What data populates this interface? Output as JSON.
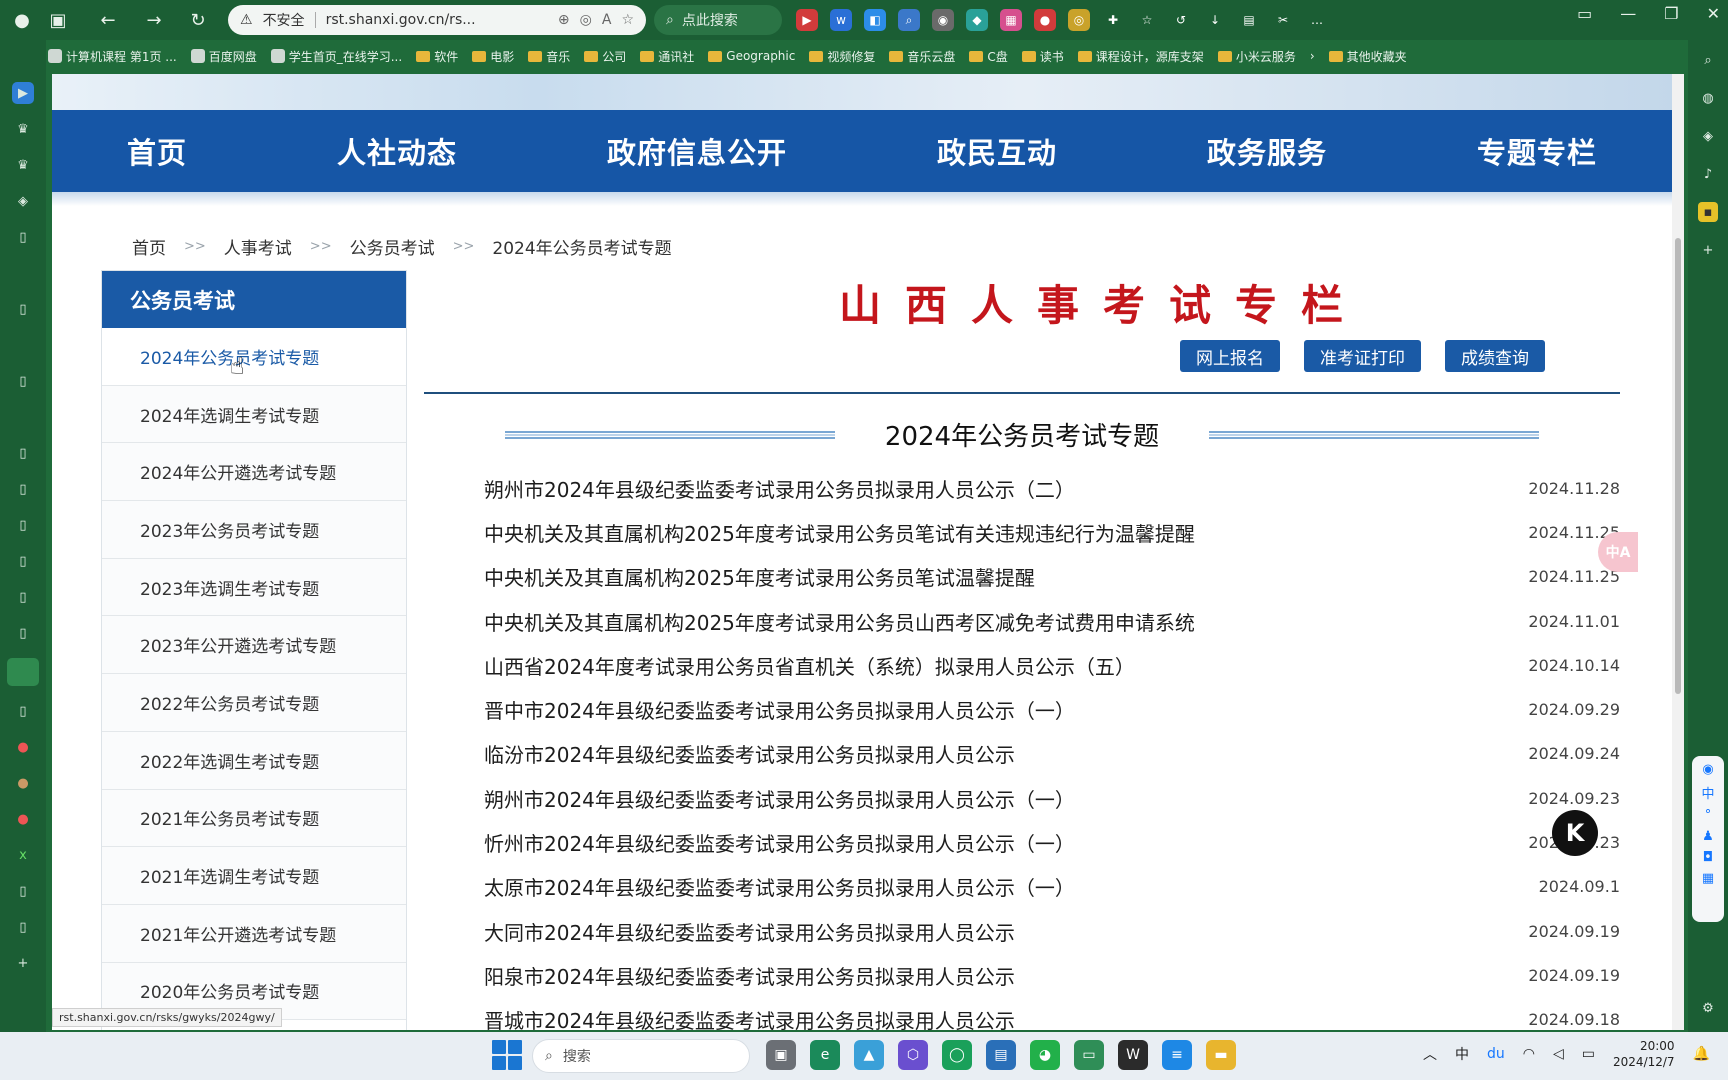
{
  "browser": {
    "security_label": "不安全",
    "url": "rst.shanxi.gov.cn/rs...",
    "search_placeholder": "点此搜索",
    "bookmarks": [
      {
        "label": "计算机课程 第1页 ..."
      },
      {
        "label": "百度网盘"
      },
      {
        "label": "学生首页_在线学习..."
      },
      {
        "label": "软件"
      },
      {
        "label": "电影"
      },
      {
        "label": "音乐"
      },
      {
        "label": "公司"
      },
      {
        "label": "通讯社"
      },
      {
        "label": "Geographic"
      },
      {
        "label": "视频修复"
      },
      {
        "label": "音乐云盘"
      },
      {
        "label": "C盘"
      },
      {
        "label": "读书"
      },
      {
        "label": "课程设计，源库支架"
      },
      {
        "label": "小米云服务"
      },
      {
        "label": "其他收藏夹"
      }
    ],
    "status_url": "rst.shanxi.gov.cn/rsks/gwyks/2024gwy/"
  },
  "nav": {
    "items": [
      {
        "label": "首页"
      },
      {
        "label": "人社动态"
      },
      {
        "label": "政府信息公开"
      },
      {
        "label": "政民互动"
      },
      {
        "label": "政务服务"
      },
      {
        "label": "专题专栏"
      }
    ]
  },
  "breadcrumb": {
    "sep": ">>",
    "items": [
      {
        "label": "首页"
      },
      {
        "label": "人事考试"
      },
      {
        "label": "公务员考试"
      },
      {
        "label": "2024年公务员考试专题"
      }
    ]
  },
  "sidebar": {
    "title": "公务员考试",
    "items": [
      {
        "label": "2024年公务员考试专题"
      },
      {
        "label": "2024年选调生考试专题"
      },
      {
        "label": "2024年公开遴选考试专题"
      },
      {
        "label": "2023年公务员考试专题"
      },
      {
        "label": "2023年选调生考试专题"
      },
      {
        "label": "2023年公开遴选考试专题"
      },
      {
        "label": "2022年公务员考试专题"
      },
      {
        "label": "2022年选调生考试专题"
      },
      {
        "label": "2021年公务员考试专题"
      },
      {
        "label": "2021年选调生考试专题"
      },
      {
        "label": "2021年公开遴选考试专题"
      },
      {
        "label": "2020年公务员考试专题"
      }
    ]
  },
  "main": {
    "title": "山西人事考试专栏",
    "buttons": [
      {
        "label": "网上报名"
      },
      {
        "label": "准考证打印"
      },
      {
        "label": "成绩查询"
      }
    ],
    "section_title": "2024年公务员考试专题",
    "news": [
      {
        "title": "朔州市2024年县级纪委监委考试录用公务员拟录用人员公示（二）",
        "date": "2024.11.28"
      },
      {
        "title": "中央机关及其直属机构2025年度考试录用公务员笔试有关违规违纪行为温馨提醒",
        "date": "2024.11.25"
      },
      {
        "title": "中央机关及其直属机构2025年度考试录用公务员笔试温馨提醒",
        "date": "2024.11.25"
      },
      {
        "title": "中央机关及其直属机构2025年度考试录用公务员山西考区减免考试费用申请系统",
        "date": "2024.11.01"
      },
      {
        "title": "山西省2024年度考试录用公务员省直机关（系统）拟录用人员公示（五）",
        "date": "2024.10.14"
      },
      {
        "title": "晋中市2024年县级纪委监委考试录用公务员拟录用人员公示（一）",
        "date": "2024.09.29"
      },
      {
        "title": "临汾市2024年县级纪委监委考试录用公务员拟录用人员公示",
        "date": "2024.09.24"
      },
      {
        "title": "朔州市2024年县级纪委监委考试录用公务员拟录用人员公示（一）",
        "date": "2024.09.23"
      },
      {
        "title": "忻州市2024年县级纪委监委考试录用公务员拟录用人员公示（一）",
        "date": "2024.09.23"
      },
      {
        "title": "太原市2024年县级纪委监委考试录用公务员拟录用人员公示（一）",
        "date": "2024.09.1"
      },
      {
        "title": "大同市2024年县级纪委监委考试录用公务员拟录用人员公示",
        "date": "2024.09.19"
      },
      {
        "title": "阳泉市2024年县级纪委监委考试录用公务员拟录用人员公示",
        "date": "2024.09.19"
      },
      {
        "title": "晋城市2024年县级纪委监委考试录用公务员拟录用人员公示",
        "date": "2024.09.18"
      }
    ]
  },
  "overlays": {
    "translate_chip": "中A",
    "k_badge": "K"
  },
  "taskbar": {
    "search_label": "搜索",
    "ime": "中",
    "time": "20:00",
    "date": "2024/12/7"
  },
  "colors": {
    "nav_blue": "#1656a6",
    "title_red": "#c4161c",
    "chrome_green": "#1b5e34"
  }
}
